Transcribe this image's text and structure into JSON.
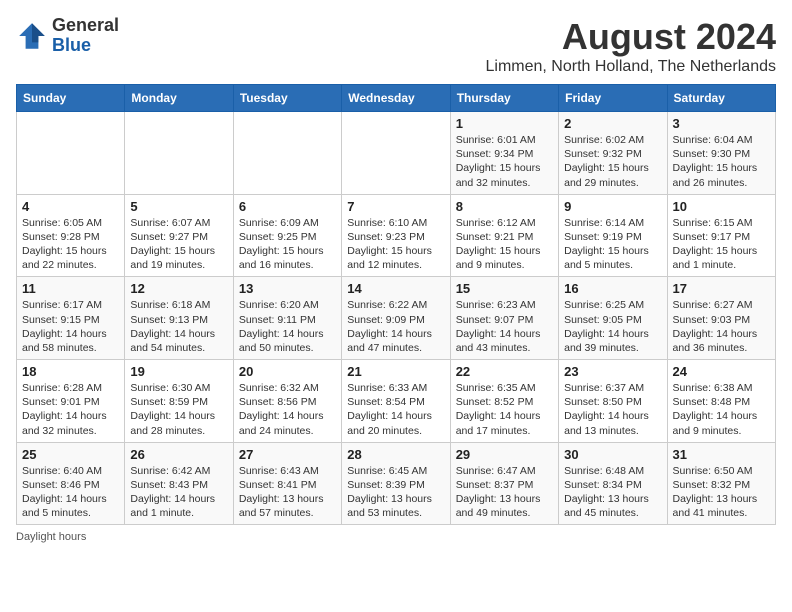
{
  "header": {
    "logo_line1": "General",
    "logo_line2": "Blue",
    "month_year": "August 2024",
    "location": "Limmen, North Holland, The Netherlands"
  },
  "weekdays": [
    "Sunday",
    "Monday",
    "Tuesday",
    "Wednesday",
    "Thursday",
    "Friday",
    "Saturday"
  ],
  "weeks": [
    [
      {
        "day": "",
        "detail": ""
      },
      {
        "day": "",
        "detail": ""
      },
      {
        "day": "",
        "detail": ""
      },
      {
        "day": "",
        "detail": ""
      },
      {
        "day": "1",
        "detail": "Sunrise: 6:01 AM\nSunset: 9:34 PM\nDaylight: 15 hours and 32 minutes."
      },
      {
        "day": "2",
        "detail": "Sunrise: 6:02 AM\nSunset: 9:32 PM\nDaylight: 15 hours and 29 minutes."
      },
      {
        "day": "3",
        "detail": "Sunrise: 6:04 AM\nSunset: 9:30 PM\nDaylight: 15 hours and 26 minutes."
      }
    ],
    [
      {
        "day": "4",
        "detail": "Sunrise: 6:05 AM\nSunset: 9:28 PM\nDaylight: 15 hours and 22 minutes."
      },
      {
        "day": "5",
        "detail": "Sunrise: 6:07 AM\nSunset: 9:27 PM\nDaylight: 15 hours and 19 minutes."
      },
      {
        "day": "6",
        "detail": "Sunrise: 6:09 AM\nSunset: 9:25 PM\nDaylight: 15 hours and 16 minutes."
      },
      {
        "day": "7",
        "detail": "Sunrise: 6:10 AM\nSunset: 9:23 PM\nDaylight: 15 hours and 12 minutes."
      },
      {
        "day": "8",
        "detail": "Sunrise: 6:12 AM\nSunset: 9:21 PM\nDaylight: 15 hours and 9 minutes."
      },
      {
        "day": "9",
        "detail": "Sunrise: 6:14 AM\nSunset: 9:19 PM\nDaylight: 15 hours and 5 minutes."
      },
      {
        "day": "10",
        "detail": "Sunrise: 6:15 AM\nSunset: 9:17 PM\nDaylight: 15 hours and 1 minute."
      }
    ],
    [
      {
        "day": "11",
        "detail": "Sunrise: 6:17 AM\nSunset: 9:15 PM\nDaylight: 14 hours and 58 minutes."
      },
      {
        "day": "12",
        "detail": "Sunrise: 6:18 AM\nSunset: 9:13 PM\nDaylight: 14 hours and 54 minutes."
      },
      {
        "day": "13",
        "detail": "Sunrise: 6:20 AM\nSunset: 9:11 PM\nDaylight: 14 hours and 50 minutes."
      },
      {
        "day": "14",
        "detail": "Sunrise: 6:22 AM\nSunset: 9:09 PM\nDaylight: 14 hours and 47 minutes."
      },
      {
        "day": "15",
        "detail": "Sunrise: 6:23 AM\nSunset: 9:07 PM\nDaylight: 14 hours and 43 minutes."
      },
      {
        "day": "16",
        "detail": "Sunrise: 6:25 AM\nSunset: 9:05 PM\nDaylight: 14 hours and 39 minutes."
      },
      {
        "day": "17",
        "detail": "Sunrise: 6:27 AM\nSunset: 9:03 PM\nDaylight: 14 hours and 36 minutes."
      }
    ],
    [
      {
        "day": "18",
        "detail": "Sunrise: 6:28 AM\nSunset: 9:01 PM\nDaylight: 14 hours and 32 minutes."
      },
      {
        "day": "19",
        "detail": "Sunrise: 6:30 AM\nSunset: 8:59 PM\nDaylight: 14 hours and 28 minutes."
      },
      {
        "day": "20",
        "detail": "Sunrise: 6:32 AM\nSunset: 8:56 PM\nDaylight: 14 hours and 24 minutes."
      },
      {
        "day": "21",
        "detail": "Sunrise: 6:33 AM\nSunset: 8:54 PM\nDaylight: 14 hours and 20 minutes."
      },
      {
        "day": "22",
        "detail": "Sunrise: 6:35 AM\nSunset: 8:52 PM\nDaylight: 14 hours and 17 minutes."
      },
      {
        "day": "23",
        "detail": "Sunrise: 6:37 AM\nSunset: 8:50 PM\nDaylight: 14 hours and 13 minutes."
      },
      {
        "day": "24",
        "detail": "Sunrise: 6:38 AM\nSunset: 8:48 PM\nDaylight: 14 hours and 9 minutes."
      }
    ],
    [
      {
        "day": "25",
        "detail": "Sunrise: 6:40 AM\nSunset: 8:46 PM\nDaylight: 14 hours and 5 minutes."
      },
      {
        "day": "26",
        "detail": "Sunrise: 6:42 AM\nSunset: 8:43 PM\nDaylight: 14 hours and 1 minute."
      },
      {
        "day": "27",
        "detail": "Sunrise: 6:43 AM\nSunset: 8:41 PM\nDaylight: 13 hours and 57 minutes."
      },
      {
        "day": "28",
        "detail": "Sunrise: 6:45 AM\nSunset: 8:39 PM\nDaylight: 13 hours and 53 minutes."
      },
      {
        "day": "29",
        "detail": "Sunrise: 6:47 AM\nSunset: 8:37 PM\nDaylight: 13 hours and 49 minutes."
      },
      {
        "day": "30",
        "detail": "Sunrise: 6:48 AM\nSunset: 8:34 PM\nDaylight: 13 hours and 45 minutes."
      },
      {
        "day": "31",
        "detail": "Sunrise: 6:50 AM\nSunset: 8:32 PM\nDaylight: 13 hours and 41 minutes."
      }
    ]
  ],
  "footer": "Daylight hours"
}
